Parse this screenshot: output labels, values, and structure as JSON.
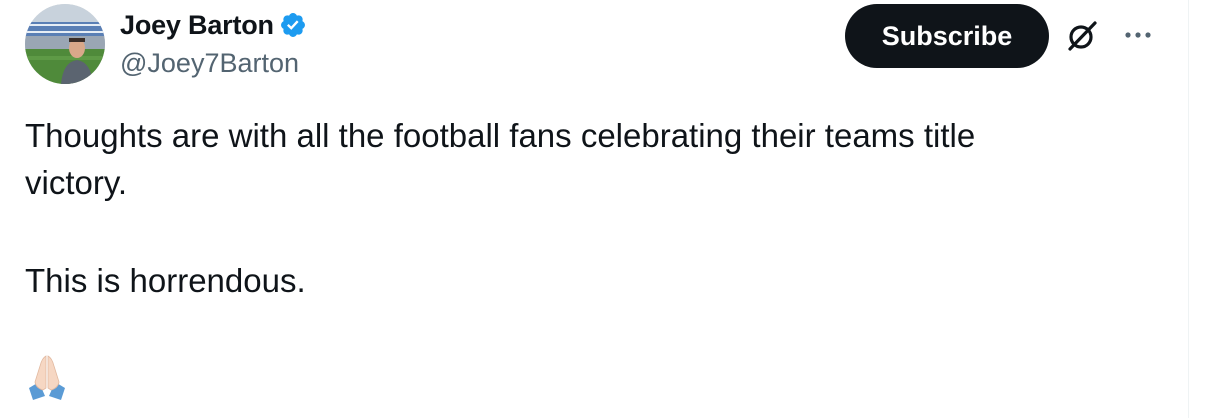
{
  "author": {
    "display_name": "Joey Barton",
    "handle": "@Joey7Barton",
    "verified": true,
    "verified_color": "#1d9bf0",
    "avatar_icon": "profile-photo"
  },
  "actions": {
    "subscribe_label": "Subscribe",
    "grok_icon": "grok-icon",
    "more_icon": "more-options-icon"
  },
  "tweet": {
    "line1": "Thoughts are with all the football fans celebrating their teams title",
    "line2": "victory.",
    "paragraph2": "This is horrendous.",
    "emoji": "🙏🏻",
    "emoji_name": "folded-hands-icon"
  },
  "colors": {
    "text": "#0f1419",
    "secondary": "#536471",
    "button_bg": "#0f1419",
    "button_text": "#ffffff"
  }
}
